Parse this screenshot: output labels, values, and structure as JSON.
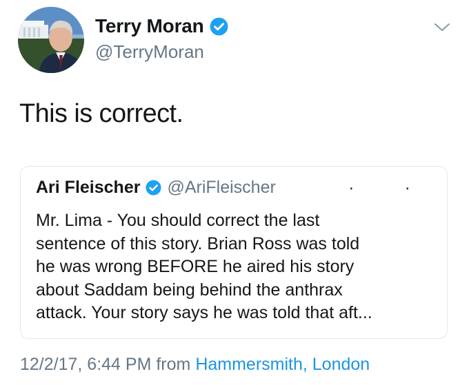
{
  "author": {
    "display_name": "Terry Moran",
    "handle": "@TerryMoran",
    "verified": true,
    "avatar_icon": "profile-photo"
  },
  "tweet": {
    "text": "This is correct."
  },
  "quoted_tweet": {
    "display_name": "Ari Fleischer",
    "handle": "@AriFleischer",
    "verified": true,
    "dots": ". .",
    "text": "Mr. Lima - You should correct the last\nsentence of this story.  Brian Ross was told\nhe was wrong BEFORE he aired his story\nabout Saddam being behind the anthrax\nattack. Your story says he was told that aft..."
  },
  "meta": {
    "timestamp": "12/2/17, 6:44 PM",
    "from_label": " from ",
    "location": "Hammersmith, London"
  },
  "icons": {
    "menu": "chevron-down-icon",
    "verified": "verified-badge-icon"
  },
  "colors": {
    "text": "#14171a",
    "secondary": "#657786",
    "link": "#1b95e0",
    "verified": "#1da1f2",
    "border": "#e1e8ed"
  }
}
